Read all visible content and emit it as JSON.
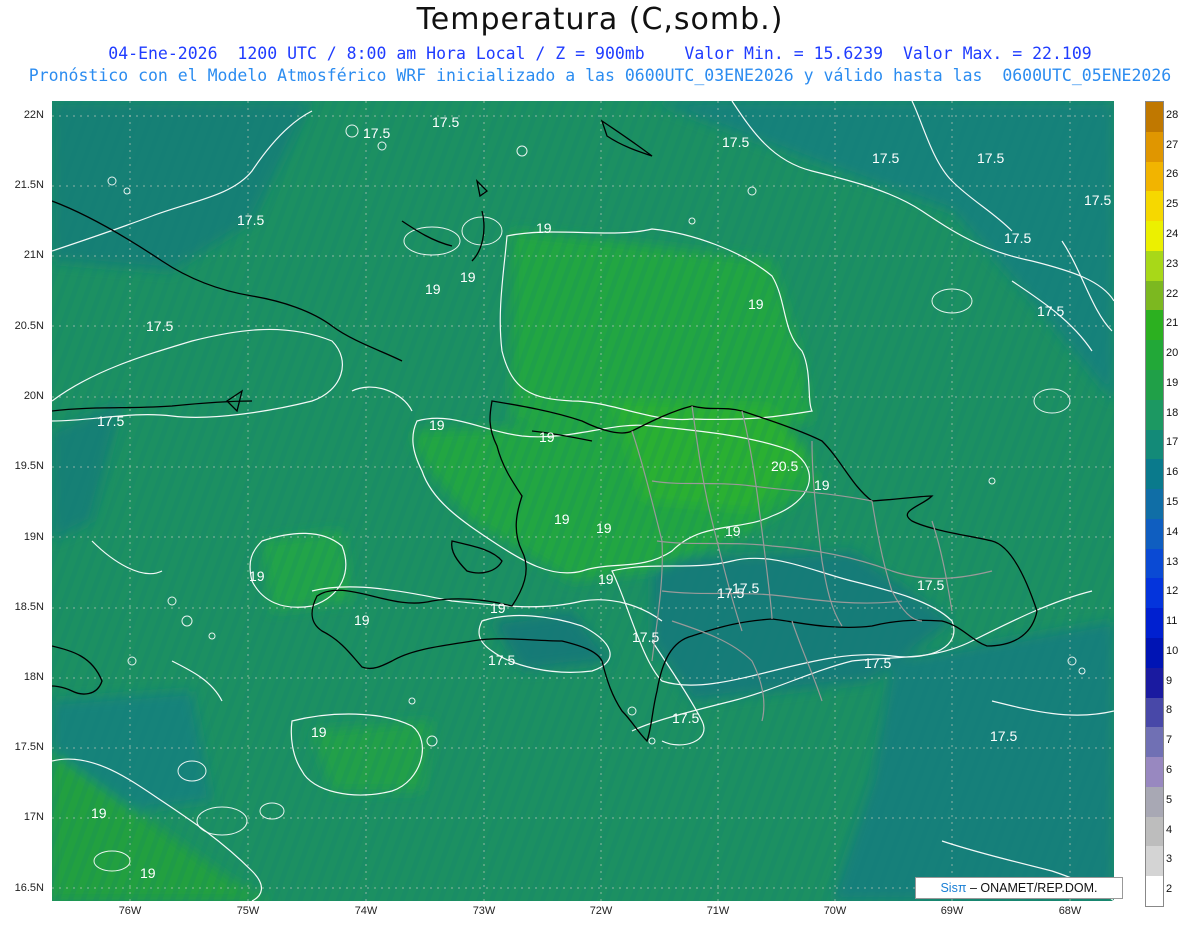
{
  "title": "Temperatura (C,somb.)",
  "subtitle_line1": "04-Ene-2026  1200 UTC / 8:00 am Hora Local / Z = 900mb    Valor Min. = 15.6239  Valor Max. = 22.109",
  "subtitle_line2": "Pronóstico con el Modelo Atmosférico WRF inicializado a las 0600UTC_03ENE2026 y válido hasta las  0600UTC_05ENE2026",
  "credit": {
    "brand": "Sisπ",
    "text": " – ONAMET/REP.DOM."
  },
  "lat_labels": [
    "22N",
    "21.5N",
    "21N",
    "20.5N",
    "20N",
    "19.5N",
    "19N",
    "18.5N",
    "18N",
    "17.5N",
    "17N",
    "16.5N"
  ],
  "lon_labels": [
    "76W",
    "75W",
    "74W",
    "73W",
    "72W",
    "71W",
    "70W",
    "69W",
    "68W"
  ],
  "colorbar": {
    "levels": [
      "28",
      "27",
      "26",
      "25",
      "24",
      "23",
      "22",
      "21",
      "20",
      "19",
      "18",
      "17",
      "16",
      "15",
      "14",
      "13",
      "12",
      "11",
      "10",
      "9",
      "8",
      "7",
      "6",
      "5",
      "4",
      "3",
      "2"
    ],
    "colors": [
      "#c07800",
      "#e09600",
      "#f2b400",
      "#f6d800",
      "#ecf000",
      "#a8d818",
      "#7cb820",
      "#2cb020",
      "#22a838",
      "#20a048",
      "#1c9862",
      "#138a78",
      "#0a7a8c",
      "#106ea6",
      "#0f5ec0",
      "#0a4ad4",
      "#0434dc",
      "#0020d0",
      "#0014b4",
      "#1a1aa0",
      "#4848a8",
      "#7070b4",
      "#9888c0",
      "#a8a8b4",
      "#bdbdbd",
      "#d4d4d4",
      "#ffffff"
    ]
  },
  "contour_labels": [
    "17.5",
    "19",
    "20.5"
  ],
  "value_range": {
    "min": 15.6239,
    "max": 22.109
  }
}
